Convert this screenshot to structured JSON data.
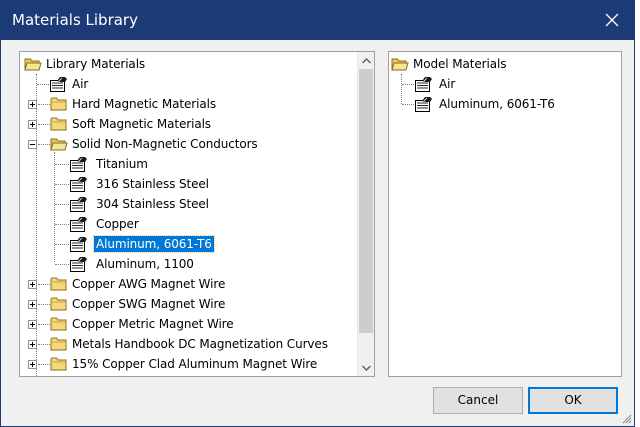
{
  "window": {
    "title": "Materials Library"
  },
  "library": {
    "root": "Library Materials",
    "items": [
      "Air",
      "Hard Magnetic Materials",
      "Soft Magnetic Materials",
      "Solid Non-Magnetic Conductors",
      "Titanium",
      "316 Stainless Steel",
      "304 Stainless Steel",
      "Copper",
      "Aluminum, 6061-T6",
      "Aluminum, 1100",
      "Copper AWG Magnet Wire",
      "Copper SWG Magnet Wire",
      "Copper Metric Magnet Wire",
      "Metals Handbook DC Magnetization Curves",
      "15% Copper Clad Aluminum Magnet Wire"
    ],
    "selected": "Aluminum, 6061-T6"
  },
  "model": {
    "root": "Model Materials",
    "items": [
      "Air",
      "Aluminum, 6061-T6"
    ]
  },
  "buttons": {
    "cancel": "Cancel",
    "ok": "OK"
  },
  "icons": {
    "close": "close-icon",
    "folder": "folder-icon",
    "material": "material-icon",
    "scroll_up": "chevron-up-icon",
    "scroll_down": "chevron-down-icon",
    "grip": "resize-grip-icon"
  },
  "colors": {
    "titlebar": "#1c3b76",
    "selection": "#0078d7",
    "ok_border": "#0078d7"
  }
}
